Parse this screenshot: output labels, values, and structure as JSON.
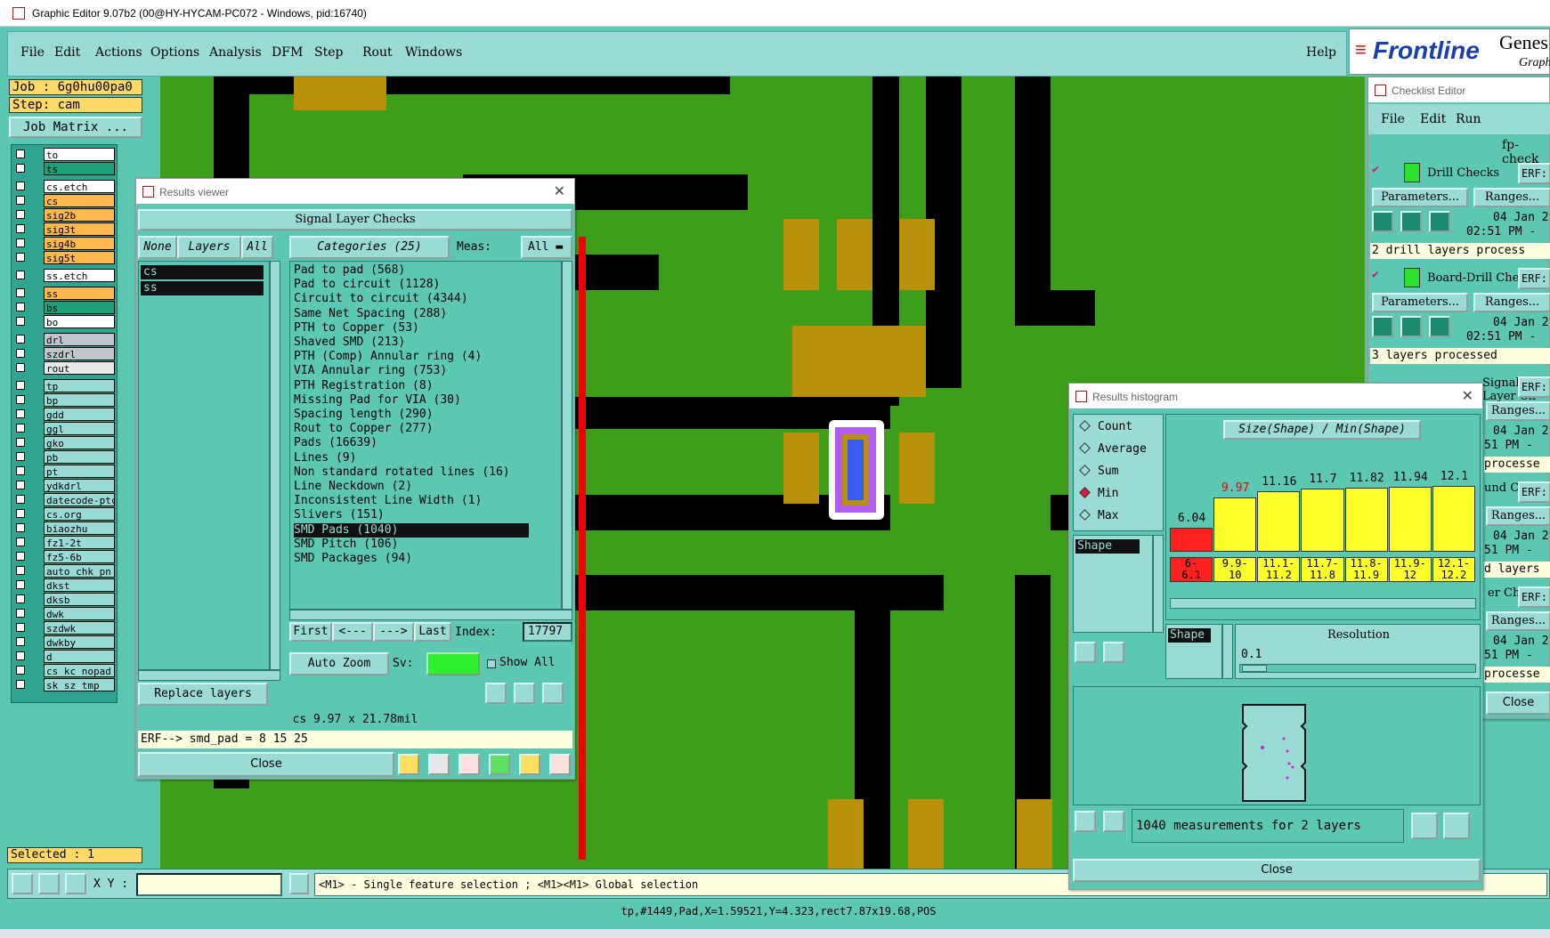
{
  "window": {
    "title": "Graphic Editor 9.07b2 (00@HY-HYCAM-PC072 - Windows, pid:16740)"
  },
  "menu": {
    "items": [
      "File",
      "Edit",
      "Actions",
      "Options",
      "Analysis",
      "DFM",
      "Step",
      "Rout",
      "Windows"
    ],
    "help": "Help"
  },
  "logo": {
    "brand": "Frontline",
    "product": "Genes",
    "sub": "Graph"
  },
  "job": {
    "job_label": "Job : 6g0hu00pa0",
    "step_label": "Step: cam",
    "matrix_button": "Job Matrix ..."
  },
  "layers": [
    {
      "name": "to",
      "color": "#ffffff"
    },
    {
      "name": "ts",
      "color": "#1f9e7a"
    },
    {
      "name": "cs.etch",
      "color": "#ffffff"
    },
    {
      "name": "cs",
      "color": "#ffb84d"
    },
    {
      "name": "sig2b",
      "color": "#ffb84d"
    },
    {
      "name": "sig3t",
      "color": "#ffb84d"
    },
    {
      "name": "sig4b",
      "color": "#ffb84d"
    },
    {
      "name": "sig5t",
      "color": "#ffb84d"
    },
    {
      "name": "ss.etch",
      "color": "#ffffff"
    },
    {
      "name": "ss",
      "color": "#ffb84d"
    },
    {
      "name": "bs",
      "color": "#1f9e7a"
    },
    {
      "name": "bo",
      "color": "#ffffff"
    },
    {
      "name": "drl",
      "color": "#c0c6cc"
    },
    {
      "name": "szdrl",
      "color": "#c0c6cc"
    },
    {
      "name": "rout",
      "color": "#e8e8e8"
    },
    {
      "name": "tp",
      "color": "#9adbd6"
    },
    {
      "name": "bp",
      "color": "#9adbd6"
    },
    {
      "name": "gdd",
      "color": "#9adbd6"
    },
    {
      "name": "ggl",
      "color": "#9adbd6"
    },
    {
      "name": "gko",
      "color": "#9adbd6"
    },
    {
      "name": "pb",
      "color": "#9adbd6"
    },
    {
      "name": "pt",
      "color": "#9adbd6"
    },
    {
      "name": "ydkdrl",
      "color": "#9adbd6"
    },
    {
      "name": "datecode-ptc",
      "color": "#9adbd6"
    },
    {
      "name": "cs.org",
      "color": "#9adbd6"
    },
    {
      "name": "biaozhu",
      "color": "#9adbd6"
    },
    {
      "name": "fz1-2t",
      "color": "#9adbd6"
    },
    {
      "name": "fz5-6b",
      "color": "#9adbd6"
    },
    {
      "name": "auto_chk_pn",
      "color": "#9adbd6"
    },
    {
      "name": "dkst",
      "color": "#9adbd6"
    },
    {
      "name": "dksb",
      "color": "#9adbd6"
    },
    {
      "name": "dwk",
      "color": "#9adbd6"
    },
    {
      "name": "szdwk",
      "color": "#9adbd6"
    },
    {
      "name": "dwkby",
      "color": "#9adbd6"
    },
    {
      "name": "d",
      "color": "#9adbd6"
    },
    {
      "name": "cs_kc_nopad",
      "color": "#9adbd6"
    },
    {
      "name": "sk_sz_tmp",
      "color": "#9adbd6"
    }
  ],
  "selected": "Selected : 1",
  "results_viewer": {
    "title": "Results viewer",
    "header": "Signal Layer Checks",
    "btn_none": "None",
    "btn_layers": "Layers",
    "btn_all": "All",
    "layers": [
      "cs",
      "ss"
    ],
    "categories_label": "Categories (25)",
    "meas_label": "Meas:",
    "meas_value": "All",
    "categories": [
      "Pad to pad (568)",
      "Pad to circuit (1128)",
      "Circuit to circuit (4344)",
      "Same Net Spacing (288)",
      "PTH to Copper (53)",
      "Shaved SMD (213)",
      "PTH (Comp) Annular ring (4)",
      "VIA Annular ring (753)",
      "PTH Registration (8)",
      "Missing Pad for VIA (30)",
      "Spacing length (290)",
      "Rout to Copper (277)",
      "Pads (16639)",
      "Lines (9)",
      "Non standard rotated lines (16)",
      "Line Neckdown (2)",
      "Inconsistent Line Width (1)",
      "Slivers (151)",
      "SMD Pads (1040)",
      "SMD Pitch (106)",
      "SMD Packages (94)"
    ],
    "selected_category": "SMD Pads (1040)",
    "nav": {
      "first": "First",
      "prev": "<---",
      "next": "--->",
      "last": "Last",
      "index_label": "Index:",
      "index_value": "17797"
    },
    "auto_zoom": "Auto Zoom",
    "sv_label": "Sv:",
    "show_all": "Show All",
    "replace_layers": "Replace layers",
    "status": "cs 9.97 x 21.78mil",
    "erf": "ERF--> smd_pad = 8 15 25",
    "close": "Close",
    "icon_labels": {
      "del": "DEL",
      "ref": "REF",
      "undo": "UNDO"
    }
  },
  "histogram": {
    "title": "Results histogram",
    "modes": [
      "Count",
      "Average",
      "Sum",
      "Min",
      "Max"
    ],
    "selected_mode": "Min",
    "list_item": "Shape",
    "chart_title": "Size(Shape) / Min(Shape)",
    "bars": [
      {
        "value": "6.04",
        "bin": "6-\n6.1",
        "level": 0.35,
        "color": "#ff2020",
        "label_color": "#000"
      },
      {
        "value": "9.97",
        "bin": "9.9-\n10",
        "level": 0.8,
        "color": "#ffff2a",
        "label_color": "#e00"
      },
      {
        "value": "11.16",
        "bin": "11.1-\n11.2",
        "level": 0.9,
        "color": "#ffff2a",
        "label_color": "#000"
      },
      {
        "value": "11.7",
        "bin": "11.7-\n11.8",
        "level": 0.94,
        "color": "#ffff2a",
        "label_color": "#000"
      },
      {
        "value": "11.82",
        "bin": "11.8-\n11.9",
        "level": 0.95,
        "color": "#ffff2a",
        "label_color": "#000"
      },
      {
        "value": "11.94",
        "bin": "11.9-\n12",
        "level": 0.96,
        "color": "#ffff2a",
        "label_color": "#000"
      },
      {
        "value": "12.1",
        "bin": "12.1-\n12.2",
        "level": 0.97,
        "color": "#ffff2a",
        "label_color": "#000"
      }
    ],
    "shape_tag": "Shape",
    "resolution_label": "Resolution",
    "resolution_value": "0.1",
    "measurements": "1040 measurements for 2 layers",
    "close": "Close"
  },
  "checklist": {
    "title": "Checklist Editor",
    "menu": [
      "File",
      "Edit",
      "Run"
    ],
    "name": "fp-check",
    "checks": [
      {
        "name": "Drill Checks",
        "erf": "ERF:",
        "params": "Parameters...",
        "ranges": "Ranges...",
        "date": "04 Jan 2",
        "time": "02:51 PM -",
        "status": "2 drill layers process"
      },
      {
        "name": "Board-Drill Che",
        "erf": "ERF:",
        "params": "Parameters...",
        "ranges": "Ranges...",
        "date": "04 Jan 2",
        "time": "02:51 PM -",
        "status": "3 layers processed"
      }
    ],
    "partial_rows": [
      "Signal Layer Ch",
      "ERF:",
      "Ranges...",
      "04 Jan 2",
      "51 PM -",
      "processe",
      "und C",
      "ERF:",
      "Ranges...",
      "04 Jan 2",
      "51 PM -",
      "d layers",
      "er Ch",
      "ERF:",
      "Ranges...",
      "04 Jan 2",
      "51 PM -",
      "processe",
      "Close"
    ]
  },
  "bottom": {
    "xy_label": "X Y :",
    "xy_value": "",
    "hint": "<M1> - Single feature selection ; <M1><M1> Global selection",
    "status": "tp,#1449,Pad,X=1.59521,Y=4.323,rect7.87x19.68,POS"
  }
}
